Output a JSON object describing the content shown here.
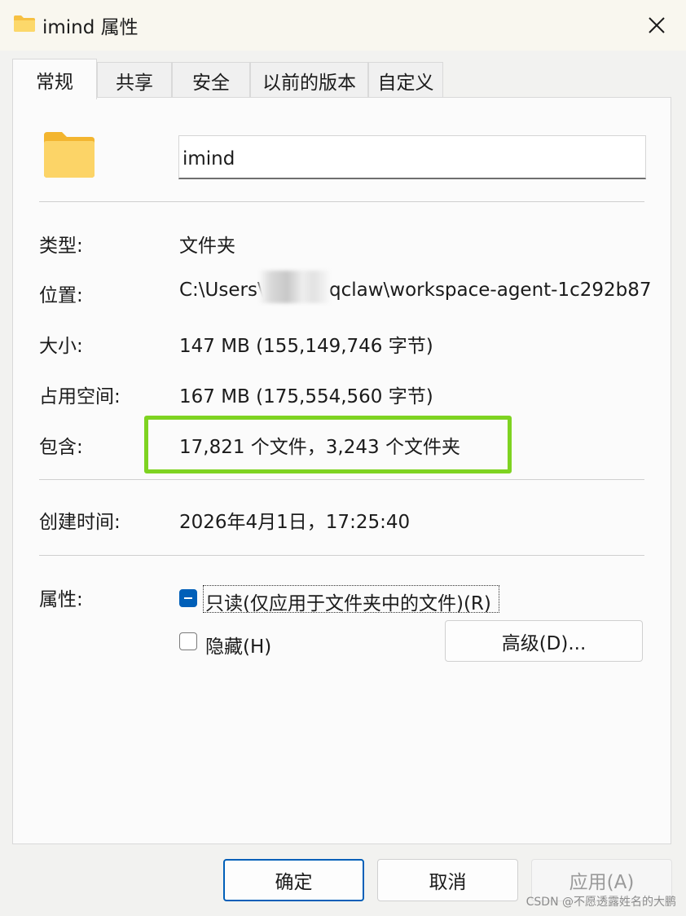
{
  "window": {
    "title": "imind 属性",
    "close_icon": "close-icon"
  },
  "tabs": [
    {
      "label": "常规",
      "active": true
    },
    {
      "label": "共享"
    },
    {
      "label": "安全"
    },
    {
      "label": "以前的版本"
    },
    {
      "label": "自定义"
    }
  ],
  "folder": {
    "name": "imind",
    "icon": "folder-icon",
    "color": "#f8c44a"
  },
  "properties": {
    "type_label": "类型:",
    "type_value": "文件夹",
    "location_label": "位置:",
    "location_prefix": "C:\\Users\\",
    "location_suffix": "qclaw\\workspace-agent-1c292b87",
    "size_label": "大小:",
    "size_value": "147 MB (155,149,746 字节)",
    "disk_size_label": "占用空间:",
    "disk_size_value": "167 MB (175,554,560 字节)",
    "contains_label": "包含:",
    "contains_value": "17,821 个文件，3,243 个文件夹",
    "created_label": "创建时间:",
    "created_value": "2026年4月1日，17:25:40"
  },
  "attributes": {
    "label": "属性:",
    "readonly_label": "只读(仅应用于文件夹中的文件)(R)",
    "readonly_state": "indeterminate",
    "hidden_label": "隐藏(H)",
    "hidden_checked": false,
    "advanced_button": "高级(D)..."
  },
  "buttons": {
    "ok": "确定",
    "cancel": "取消",
    "apply": "应用(A)"
  },
  "watermark": "CSDN @不愿透露姓名的大鹏",
  "colors": {
    "accent": "#005fb8",
    "highlight": "#7ed321"
  }
}
